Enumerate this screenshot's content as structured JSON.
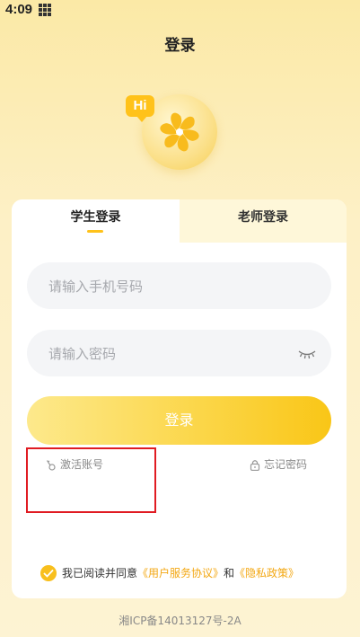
{
  "status_bar": {
    "time": "4:09"
  },
  "header": {
    "title": "登录"
  },
  "logo": {
    "badge": "Hi"
  },
  "tabs": [
    {
      "label": "学生登录",
      "active": true
    },
    {
      "label": "老师登录",
      "active": false
    }
  ],
  "form": {
    "phone_placeholder": "请输入手机号码",
    "password_placeholder": "请输入密码",
    "login_label": "登录"
  },
  "links": {
    "activate": "激活账号",
    "forgot": "忘记密码"
  },
  "agreement": {
    "prefix": "我已阅读并同意",
    "user_agreement": "《用户服务协议》",
    "and": "和",
    "privacy_policy": "《隐私政策》"
  },
  "footer": {
    "icp": "湘ICP备14013127号-2A"
  },
  "colors": {
    "accent": "#f9c617",
    "highlight": "#e01b22"
  }
}
